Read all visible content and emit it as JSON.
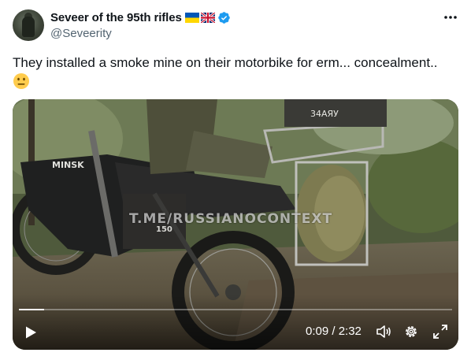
{
  "author": {
    "display_name": "Seveer of the 95th rifles",
    "handle": "@Seveerity",
    "flags": [
      "ukraine-flag-icon",
      "uk-flag-icon"
    ],
    "verified_icon": "verified-badge-icon"
  },
  "tweet": {
    "text": "They installed a smoke mine on their motorbike for erm... concealment..",
    "emoji": "neutral-face-icon"
  },
  "video": {
    "watermark": "T.ME/RUSSIANOCONTEXT",
    "bike_brand": "MINSK",
    "crate_text": "34AЯУ",
    "plate_text": "150",
    "time": "0:09 / 2:32",
    "progress": 0.059,
    "icons": [
      "play-icon",
      "volume-icon",
      "settings-gear-icon",
      "fullscreen-icon"
    ]
  },
  "colors": {
    "text": "#0f1419",
    "secondary": "#536471",
    "verified": "#1d9bf0"
  }
}
